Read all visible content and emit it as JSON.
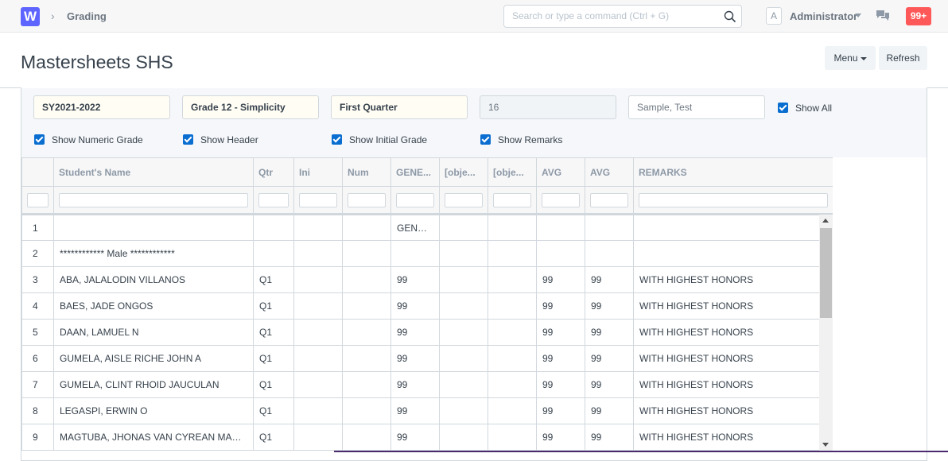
{
  "navbar": {
    "logo_letter": "W",
    "breadcrumb": "Grading",
    "search_placeholder": "Search or type a command (Ctrl + G)",
    "avatar_letter": "A",
    "user_name": "Administrator",
    "notification_count": "99+"
  },
  "page": {
    "title": "Mastersheets SHS",
    "menu_label": "Menu",
    "refresh_label": "Refresh"
  },
  "filters": {
    "school_year": "SY2021-2022",
    "section": "Grade 12 - Simplicity",
    "quarter": "First Quarter",
    "number": "16",
    "teacher": "Sample, Test",
    "show_all": "Show All",
    "show_numeric_grade": "Show Numeric Grade",
    "show_header": "Show Header",
    "show_initial_grade": "Show Initial Grade",
    "show_remarks": "Show Remarks"
  },
  "grid": {
    "columns": [
      "",
      "Student's Name",
      "Qtr",
      "Ini",
      "Num",
      "GENE...",
      "[obje...",
      "[obje...",
      "AVG",
      "AVG",
      "REMARKS"
    ],
    "rows": [
      [
        "1",
        "",
        "",
        "",
        "",
        "GENER...",
        "",
        "",
        "",
        "",
        ""
      ],
      [
        "2",
        "************ Male ************",
        "",
        "",
        "",
        "",
        "",
        "",
        "",
        "",
        ""
      ],
      [
        "3",
        "ABA, JALALODIN VILLANOS",
        "Q1",
        "",
        "",
        "99",
        "",
        "",
        "99",
        "99",
        "WITH HIGHEST HONORS"
      ],
      [
        "4",
        "BAES, JADE ONGOS",
        "Q1",
        "",
        "",
        "99",
        "",
        "",
        "99",
        "99",
        "WITH HIGHEST HONORS"
      ],
      [
        "5",
        "DAAN, LAMUEL N",
        "Q1",
        "",
        "",
        "99",
        "",
        "",
        "99",
        "99",
        "WITH HIGHEST HONORS"
      ],
      [
        "6",
        "GUMELA, AISLE RICHE JOHN A",
        "Q1",
        "",
        "",
        "99",
        "",
        "",
        "99",
        "99",
        "WITH HIGHEST HONORS"
      ],
      [
        "7",
        "GUMELA, CLINT RHOID JAUCULAN",
        "Q1",
        "",
        "",
        "99",
        "",
        "",
        "99",
        "99",
        "WITH HIGHEST HONORS"
      ],
      [
        "8",
        "LEGASPI, ERWIN O",
        "Q1",
        "",
        "",
        "99",
        "",
        "",
        "99",
        "99",
        "WITH HIGHEST HONORS"
      ],
      [
        "9",
        "MAGTUBA, JHONAS VAN CYREAN MANG...",
        "Q1",
        "",
        "",
        "99",
        "",
        "",
        "99",
        "99",
        "WITH HIGHEST HONORS"
      ]
    ]
  }
}
